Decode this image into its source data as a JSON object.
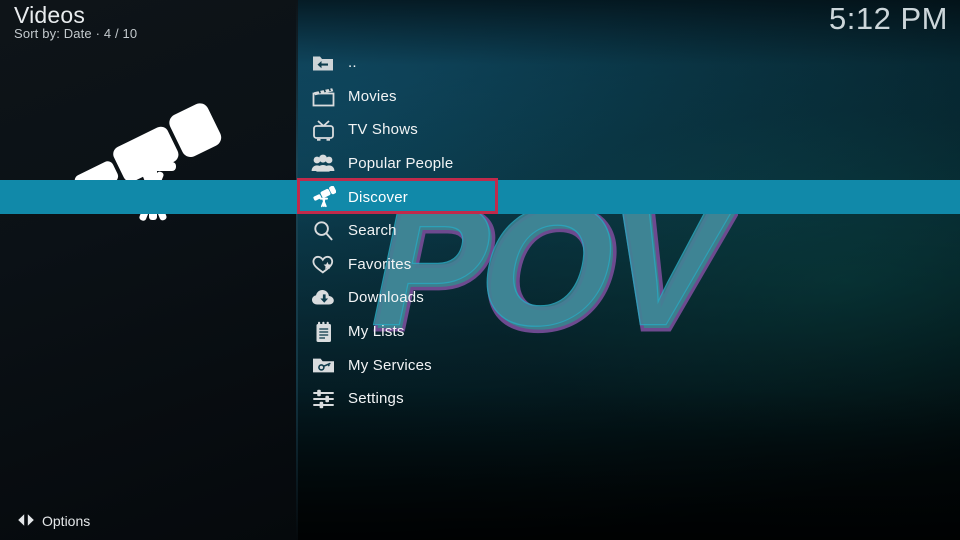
{
  "header": {
    "title": "Videos",
    "subtitle": "Sort by: Date  ·  4 / 10",
    "clock": "5:12 PM"
  },
  "watermark": {
    "text": "POV"
  },
  "menu": {
    "selected_index": 4,
    "items": [
      {
        "label": "..",
        "icon": "folder-back-icon"
      },
      {
        "label": "Movies",
        "icon": "clapperboard-icon"
      },
      {
        "label": "TV Shows",
        "icon": "television-icon"
      },
      {
        "label": "Popular People",
        "icon": "people-group-icon"
      },
      {
        "label": "Discover",
        "icon": "telescope-icon"
      },
      {
        "label": "Search",
        "icon": "magnifier-icon"
      },
      {
        "label": "Favorites",
        "icon": "heart-star-icon"
      },
      {
        "label": "Downloads",
        "icon": "cloud-download-icon"
      },
      {
        "label": "My Lists",
        "icon": "notepad-icon"
      },
      {
        "label": "My Services",
        "icon": "folder-key-icon"
      },
      {
        "label": "Settings",
        "icon": "sliders-icon"
      }
    ]
  },
  "footer": {
    "options_label": "Options",
    "options_icon": "left-right-arrows-icon"
  },
  "art": {
    "icon": "telescope-icon"
  },
  "colors": {
    "highlight": "#1189a9",
    "annotation": "#c12a4b",
    "text": "#f2f4f5",
    "icon": "#d9dcde",
    "watermark_fill": "#3d7f8d",
    "watermark_outline": "#6d4a8f"
  }
}
